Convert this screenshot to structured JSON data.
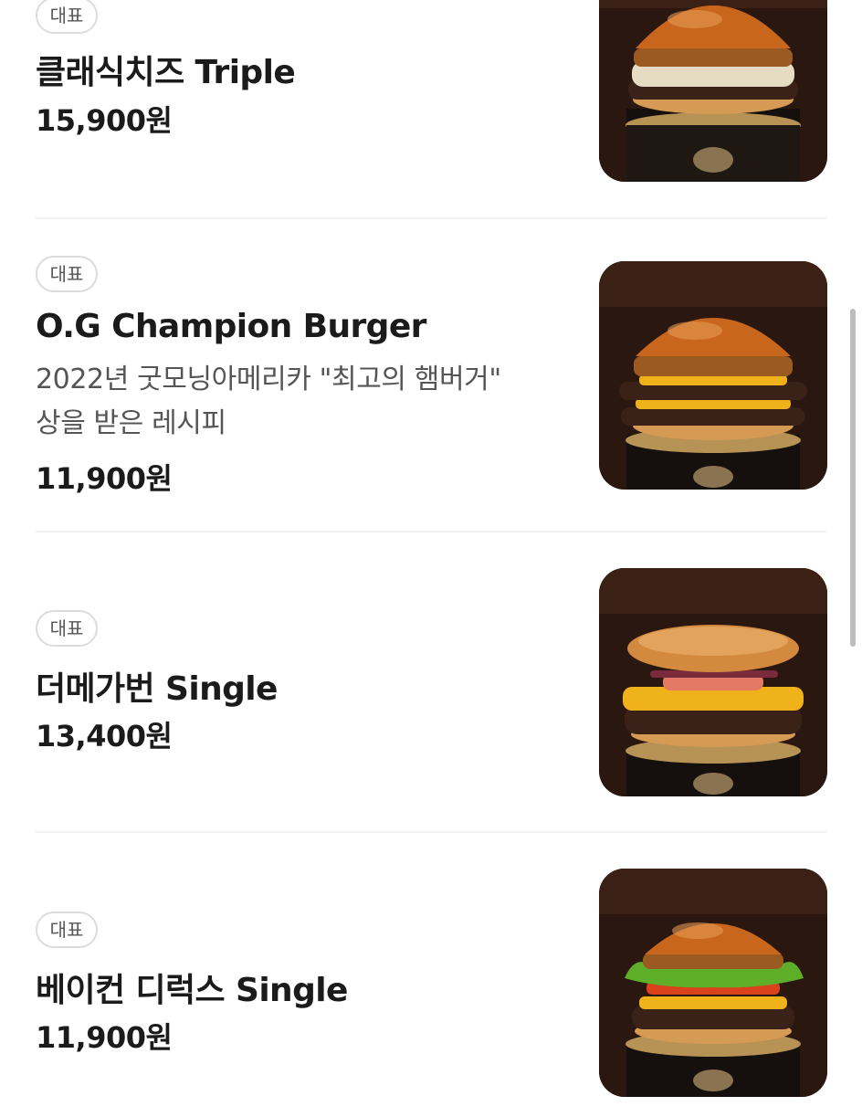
{
  "menu": {
    "items": [
      {
        "badge": "대표",
        "name": "클래식치즈 Triple",
        "description": "",
        "price": "15,900원",
        "image_icon": "classic-cheese-burger-photo"
      },
      {
        "badge": "대표",
        "name": "O.G Champion Burger",
        "description_lines": [
          "2022년 굿모닝아메리카 \"최고의 햄버거\"",
          "상을 받은 레시피"
        ],
        "price": "11,900원",
        "image_icon": "og-champion-burger-photo"
      },
      {
        "badge": "대표",
        "name": "더메가번 Single",
        "description": "",
        "price": "13,400원",
        "image_icon": "mega-bun-burger-photo"
      },
      {
        "badge": "대표",
        "name": "베이컨 디럭스 Single",
        "description": "",
        "price": "11,900원",
        "image_icon": "bacon-deluxe-burger-photo"
      }
    ]
  },
  "colors": {
    "text": "#1b1b1b",
    "secondary_text": "#555555",
    "badge_border": "#dcdcdc",
    "divider": "#f1f1f1",
    "bun": "#c8661e",
    "cheese": "#f0b21a",
    "patty": "#3a2218",
    "lettuce": "#5fae2a",
    "background_dark": "#2a1710"
  }
}
